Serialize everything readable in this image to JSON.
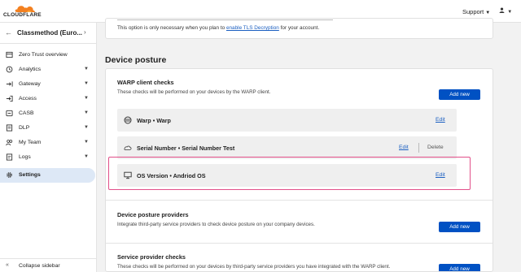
{
  "topbar": {
    "logo_text": "CLOUDFLARE",
    "support_label": "Support"
  },
  "sidebar": {
    "account_name": "Classmethod (Euro...",
    "items": [
      {
        "label": "Zero Trust overview",
        "icon": "home-icon",
        "dropdown": false
      },
      {
        "label": "Analytics",
        "icon": "clock-icon",
        "dropdown": true
      },
      {
        "label": "Gateway",
        "icon": "gateway-icon",
        "dropdown": true
      },
      {
        "label": "Access",
        "icon": "access-icon",
        "dropdown": true
      },
      {
        "label": "CASB",
        "icon": "casb-icon",
        "dropdown": true
      },
      {
        "label": "DLP",
        "icon": "dlp-icon",
        "dropdown": true
      },
      {
        "label": "My Team",
        "icon": "team-icon",
        "dropdown": true
      },
      {
        "label": "Logs",
        "icon": "logs-icon",
        "dropdown": true
      },
      {
        "label": "Settings",
        "icon": "gear-icon",
        "dropdown": false,
        "active": true
      }
    ],
    "collapse_label": "Collapse sidebar"
  },
  "main": {
    "prev_note_prefix": "This option is only necessary when you plan to ",
    "prev_note_link": "enable TLS Decryption",
    "prev_note_suffix": " for your account.",
    "section_title": "Device posture",
    "warp": {
      "title": "WARP client checks",
      "desc": "These checks will be performed on your devices by the WARP client.",
      "add_label": "Add new",
      "checks": [
        {
          "name": "Warp • Warp",
          "icon": "warp-icon",
          "edit": "Edit"
        },
        {
          "name": "Serial Number • Serial Number Test",
          "icon": "serial-icon",
          "edit": "Edit",
          "delete": "Delete"
        },
        {
          "name": "OS Version • Andriod OS",
          "icon": "monitor-icon",
          "edit": "Edit"
        }
      ]
    },
    "providers": {
      "title": "Device posture providers",
      "desc": "Integrate third-party service providers to check device posture on your company devices.",
      "add_label": "Add new"
    },
    "service": {
      "title": "Service provider checks",
      "desc": "These checks will be performed on your devices by third-party service providers you have integrated with the WARP client.",
      "add_label": "Add new"
    }
  },
  "colors": {
    "accent": "#0051c3",
    "link": "#1b5fc1",
    "highlight": "#e2508a",
    "active_nav": "#dde8f6"
  }
}
